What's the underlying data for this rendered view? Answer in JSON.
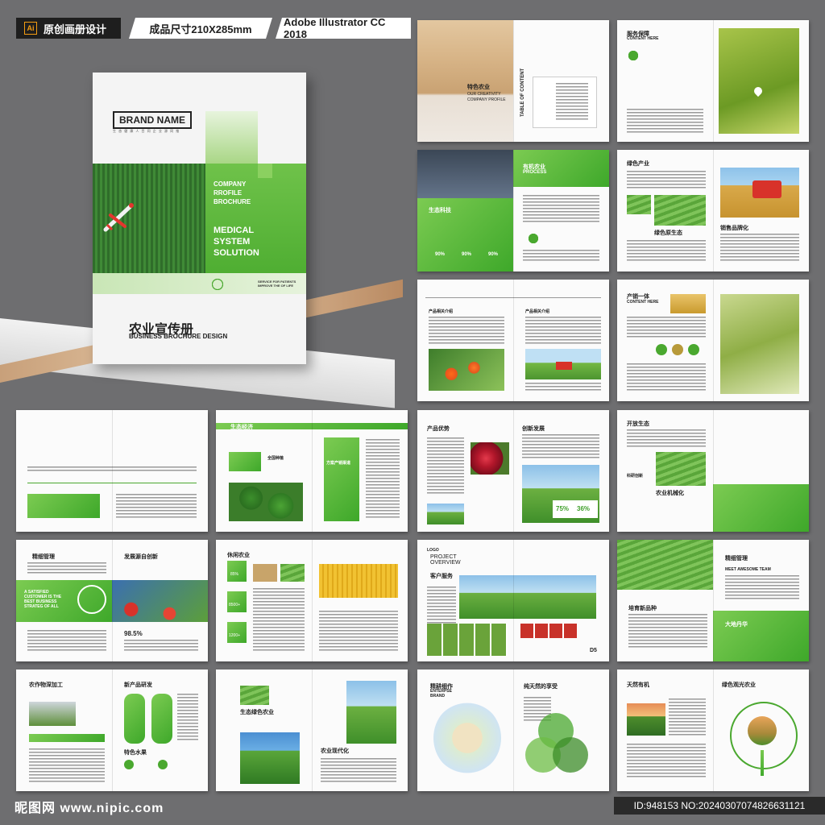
{
  "header": {
    "app_tag": "原创画册设计",
    "app_icon": "Ai",
    "size_tag": "成品尺寸210X285mm",
    "software_tag": "Adobe Illustrator CC 2018"
  },
  "cover": {
    "brand": "BRAND NAME",
    "brand_sub": "生 态 健 康 人 目 同 企 业 源 同 推",
    "line1": "COMPANY",
    "line2": "RROFILE",
    "line3": "BROCHURE",
    "head1": "MEDICAL",
    "head2": "SYSTEM",
    "head3": "SOLUTION",
    "service": "SERVICE FOR PATIENTS IMPROVE THE OF LIFE",
    "title_cn": "农业宣传册",
    "title_en": "BUSINESS BROCHURE DESIGN"
  },
  "spreads": [
    {
      "t1": "特色农业",
      "t2": "OUR CREATIVITY",
      "t3": "COMPANY PROFILE",
      "toc": "TABLE OF CONTENT"
    },
    {
      "t1": "服务保障",
      "t2": "CONTENT HERE"
    },
    {
      "t1": "有机农业",
      "t2": "PROCESS",
      "t3": "生态科技",
      "p1": "90%",
      "p2": "90%",
      "p3": "90%"
    },
    {
      "t1": "绿色产业",
      "t2": "绿色原生态",
      "t3": "销售品牌化"
    },
    {
      "t1": "产品相关介绍",
      "t2": "产品相关介绍"
    },
    {
      "t1": "产销一体",
      "t2": "CONTENT HERE"
    },
    {
      "t1": ""
    },
    {
      "t1": "生态经济",
      "t2": "全国种植",
      "t3": "方案产销渠道"
    },
    {
      "t1": "产品优势",
      "t2": "创新发展",
      "p1": "75%",
      "p2": "36%"
    },
    {
      "t1": "开放生态",
      "t2": "农业机械化",
      "t3": "科研创新"
    },
    {
      "t1": "精细管理",
      "t2": "发展源自创新",
      "t3": "A SATISFIED CUSTOMER IS THE BEST BUSINESS STRATEG OF ALL",
      "p1": "98.5%"
    },
    {
      "t1": "休闲农业",
      "t2": "85%",
      "t3": "8500+",
      "t4": "1200+"
    },
    {
      "t1": "PROJECT OVERVIEW",
      "t2": "客户服务",
      "t3": "LOGO",
      "t4": "D5"
    },
    {
      "t1": "精细管理",
      "t2": "MEET AWESOME TEAM",
      "t3": "培育新品种",
      "t4": "大地丹华"
    },
    {
      "t1": "农作物深加工",
      "t2": "新产品研发",
      "t3": "特色水果"
    },
    {
      "t1": "生态绿色农业",
      "t2": "农业现代化"
    },
    {
      "t1": "精耕细作",
      "t2": "纯天然的享受",
      "t3": "ENTERPSE BRAND"
    },
    {
      "t1": "天然有机",
      "t2": "绿色观光农业"
    }
  ],
  "footer": {
    "watermark": "昵图网 www.nipic.com",
    "id_text": "ID:948153 NO:20240307074826631121"
  },
  "colors": {
    "accent": "#4aa82f",
    "accent_light": "#7ccb52",
    "background": "#6e6e70"
  }
}
